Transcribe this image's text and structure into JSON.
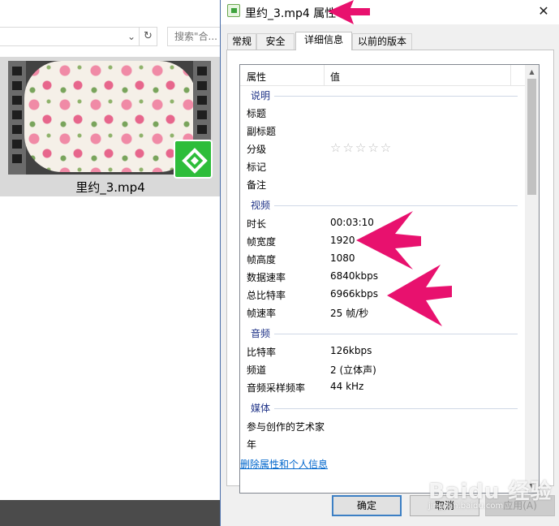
{
  "explorer": {
    "search_placeholder": "搜索\"合...",
    "file_name": "里约_3.mp4",
    "refresh_glyph": "↻",
    "dropdown_glyph": "⌄"
  },
  "dialog": {
    "title": "里约_3.mp4 属性",
    "close_glyph": "✕",
    "tabs": [
      {
        "label": "常规",
        "active": false
      },
      {
        "label": "安全",
        "active": false
      },
      {
        "label": "详细信息",
        "active": true
      },
      {
        "label": "以前的版本",
        "active": false
      }
    ],
    "columns": {
      "property": "属性",
      "value": "值"
    },
    "groups": {
      "description": {
        "label": "说明",
        "rows": [
          {
            "name": "标题",
            "value": ""
          },
          {
            "name": "副标题",
            "value": ""
          },
          {
            "name": "分级",
            "value": "☆☆☆☆☆"
          },
          {
            "name": "标记",
            "value": ""
          },
          {
            "name": "备注",
            "value": ""
          }
        ]
      },
      "video": {
        "label": "视频",
        "rows": [
          {
            "name": "时长",
            "value": "00:03:10"
          },
          {
            "name": "帧宽度",
            "value": "1920"
          },
          {
            "name": "帧高度",
            "value": "1080"
          },
          {
            "name": "数据速率",
            "value": "6840kbps"
          },
          {
            "name": "总比特率",
            "value": "6966kbps"
          },
          {
            "name": "帧速率",
            "value": "25 帧/秒"
          }
        ]
      },
      "audio": {
        "label": "音频",
        "rows": [
          {
            "name": "比特率",
            "value": "126kbps"
          },
          {
            "name": "频道",
            "value": "2 (立体声)"
          },
          {
            "name": "音频采样频率",
            "value": "44 kHz"
          }
        ]
      },
      "media": {
        "label": "媒体",
        "rows": [
          {
            "name": "参与创作的艺术家",
            "value": ""
          },
          {
            "name": "年",
            "value": ""
          }
        ]
      }
    },
    "remove_link": "删除属性和个人信息",
    "buttons": {
      "ok": "确定",
      "cancel": "取消",
      "apply": "应用(A)"
    }
  },
  "annotation_color": "#e8116e",
  "watermark": {
    "main": "Baidu 经验",
    "sub": "jingyan.baidu.com"
  }
}
